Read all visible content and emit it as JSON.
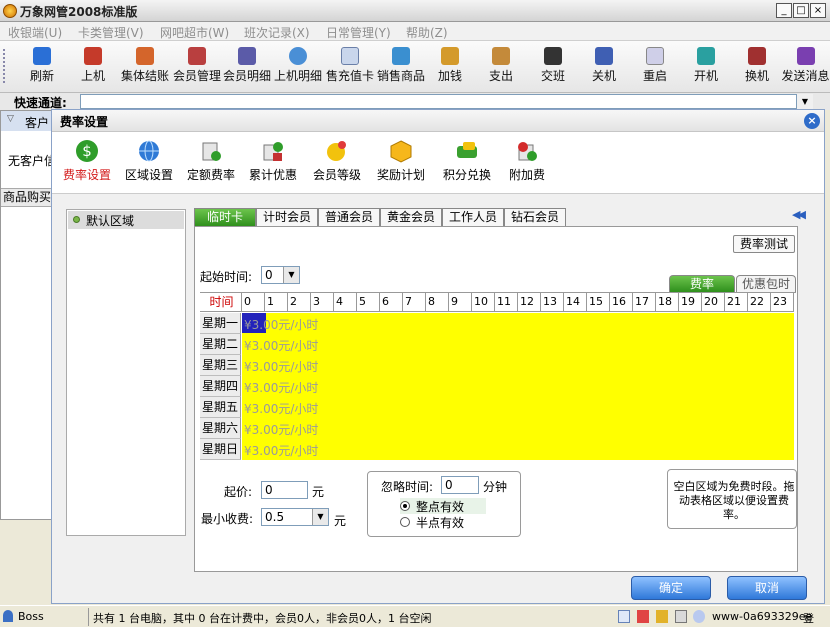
{
  "window": {
    "title": "万象网管2008标准版"
  },
  "menu": [
    "收银端(U)",
    "卡类管理(V)",
    "网吧超市(W)",
    "班次记录(X)",
    "日常管理(Y)",
    "帮助(Z)"
  ],
  "toolbar": [
    "刷新",
    "上机",
    "集体结账",
    "会员管理",
    "会员明细",
    "上机明细",
    "售充值卡",
    "销售商品",
    "加钱",
    "支出",
    "交班",
    "关机",
    "重启",
    "开机",
    "换机",
    "发送消息"
  ],
  "quick": {
    "label": "快速通道:"
  },
  "background": {
    "customer_label": "客户",
    "no_customer": "无客户信",
    "goods_label": "商品购买"
  },
  "dialog": {
    "title": "费率设置",
    "tools": [
      "费率设置",
      "区域设置",
      "定额费率",
      "累计优惠",
      "会员等级",
      "奖励计划",
      "积分兑换",
      "附加费"
    ],
    "region": "默认区域",
    "tabs": [
      "临时卡",
      "计时会员",
      "普通会员",
      "黄金会员",
      "工作人员",
      "钻石会员"
    ],
    "rate_test": "费率测试",
    "start_time_label": "起始时间:",
    "start_time_value": "0",
    "rate_tab": "费率",
    "package_tab": "优惠包时",
    "time_header": "时间",
    "hours": [
      "0",
      "1",
      "2",
      "3",
      "4",
      "5",
      "6",
      "7",
      "8",
      "9",
      "10",
      "11",
      "12",
      "13",
      "14",
      "15",
      "16",
      "17",
      "18",
      "19",
      "20",
      "21",
      "22",
      "23"
    ],
    "days": [
      "星期一",
      "星期二",
      "星期三",
      "星期四",
      "星期五",
      "星期六",
      "星期日"
    ],
    "rate_text": "¥3.00元/小时",
    "base_price_label": "起价:",
    "base_price_value": "0",
    "yuan": "元",
    "min_charge_label": "最小收费:",
    "min_charge_value": "0.5",
    "ignore_label": "忽略时间:",
    "ignore_value": "0",
    "minute": "分钟",
    "radio_whole": "整点有效",
    "radio_half": "半点有效",
    "note": "空白区域为免费时段。拖动表格区域以便设置费率。",
    "ok": "确定",
    "cancel": "取消"
  },
  "status": {
    "user": "Boss",
    "text": "共有 1 台电脑，其中 0 台在计费中，会员0人，非会员0人，1 台空闲",
    "host": "www-0a693329ee",
    "extra": "登"
  }
}
